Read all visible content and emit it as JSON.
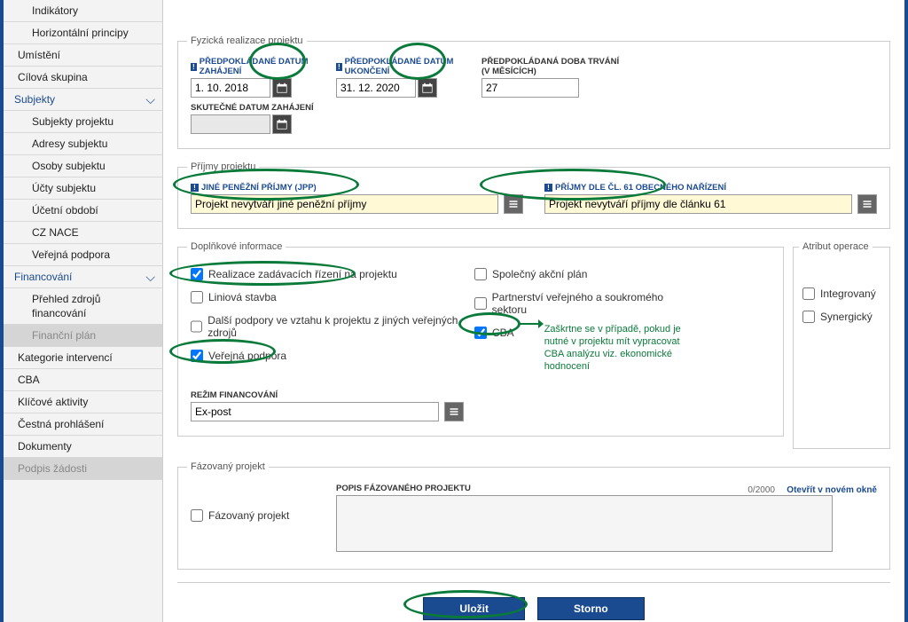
{
  "sidebar": {
    "items": [
      {
        "label": "Indikátory",
        "sub": true
      },
      {
        "label": "Horizontální principy",
        "sub": true
      },
      {
        "label": "Umístění",
        "section": "plain"
      },
      {
        "label": "Cílová skupina",
        "section": "plain"
      },
      {
        "label": "Subjekty",
        "section": "collapsible"
      },
      {
        "label": "Subjekty projektu",
        "sub": true
      },
      {
        "label": "Adresy subjektu",
        "sub": true
      },
      {
        "label": "Osoby subjektu",
        "sub": true
      },
      {
        "label": "Účty subjektu",
        "sub": true
      },
      {
        "label": "Účetní období",
        "sub": true
      },
      {
        "label": "CZ NACE",
        "sub": true
      },
      {
        "label": "Veřejná podpora",
        "sub": true
      },
      {
        "label": "Financování",
        "section": "collapsible"
      },
      {
        "label": "Přehled zdrojů financování",
        "sub": true
      },
      {
        "label": "Finanční plán",
        "sub": true,
        "active": true
      },
      {
        "label": "Kategorie intervencí",
        "section": "plain"
      },
      {
        "label": "CBA",
        "section": "plain"
      },
      {
        "label": "Klíčové aktivity",
        "section": "plain"
      },
      {
        "label": "Čestná prohlášení",
        "section": "plain"
      },
      {
        "label": "Dokumenty",
        "section": "plain"
      },
      {
        "label": "Podpis žádosti",
        "section": "plain",
        "active": true
      }
    ]
  },
  "fieldset_physical": {
    "legend": "Fyzická realizace projektu",
    "start_label": "PŘEDPOKLÁDANÉ DATUM ZAHÁJENÍ",
    "start_value": "1. 10. 2018",
    "end_label": "PŘEDPOKLÁDANÉ DATUM UKONČENÍ",
    "end_value": "31. 12. 2020",
    "duration_label": "PŘEDPOKLÁDANÁ DOBA TRVÁNÍ (V MĚSÍCÍCH)",
    "duration_value": "27",
    "actual_start_label": "SKUTEČNÉ DATUM ZAHÁJENÍ",
    "actual_start_value": ""
  },
  "fieldset_income": {
    "legend": "Příjmy projektu",
    "jpp_label": "JINÉ PENĚŽNÍ PŘÍJMY (JPP)",
    "jpp_value": "Projekt nevytváří jiné peněžní příjmy",
    "cl61_label": "PŘÍJMY DLE ČL. 61 OBECNÉHO NAŘÍZENÍ",
    "cl61_value": "Projekt nevytváří příjmy dle článku 61"
  },
  "fieldset_info": {
    "legend": "Doplňkové informace",
    "realizace": "Realizace zadávacích řízení na projektu",
    "liniova": "Liniová stavba",
    "dalsi": "Další podpory ve vztahu k projektu z jiných veřejných zdrojů",
    "verejna": "Veřejná podpora",
    "spolecny": "Společný akční plán",
    "partnerstvi": "Partnerství veřejného a soukromého sektoru",
    "cba": "CBA",
    "atribut_title": "Atribut operace",
    "integrovany": "Integrovaný",
    "synergicky": "Synergický",
    "cba_note": "Zaškrtne se v případě, pokud je nutné v projektu mít vypracovat CBA analýzu viz. ekonomické hodnocení",
    "regime_label": "REŽIM FINANCOVÁNÍ",
    "regime_value": "Ex-post"
  },
  "fieldset_phased": {
    "legend": "Fázovaný projekt",
    "checkbox": "Fázovaný projekt",
    "desc_label": "POPIS FÁZOVANÉHO PROJEKTU",
    "char_count": "0/2000",
    "open_link": "Otevřít v novém okně"
  },
  "buttons": {
    "save": "Uložit",
    "cancel": "Storno"
  }
}
